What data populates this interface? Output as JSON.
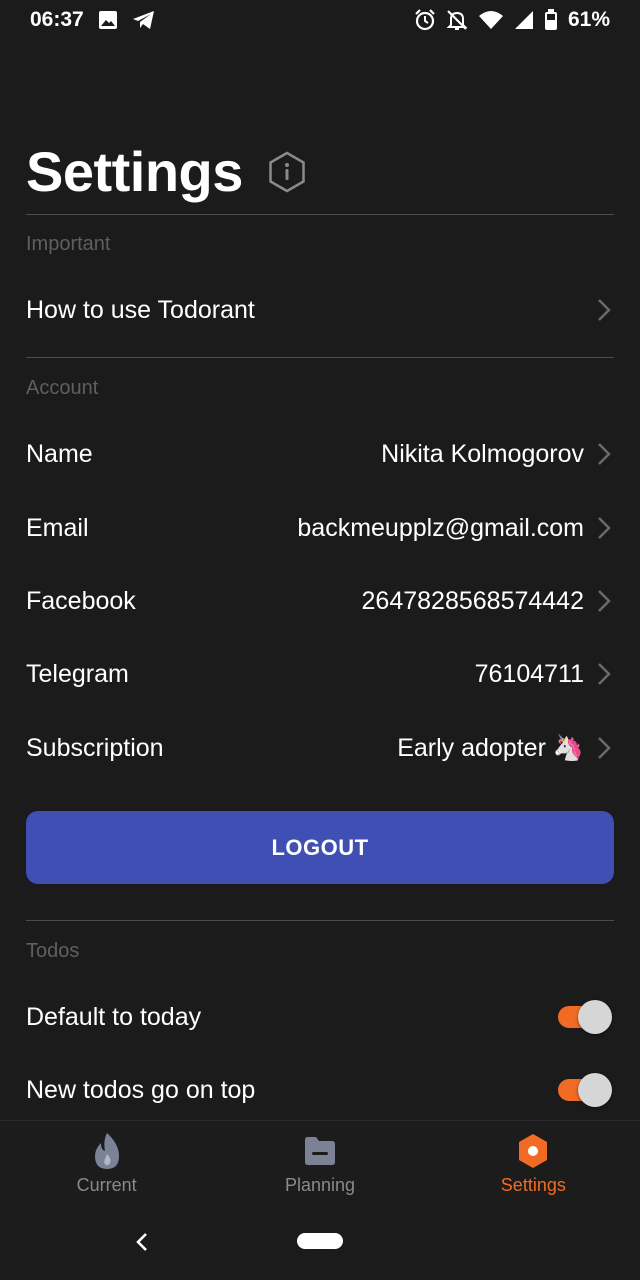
{
  "status_bar": {
    "time": "06:37",
    "battery": "61%",
    "icons_left": [
      "image-icon",
      "telegram-icon"
    ],
    "icons_right": [
      "alarm-icon",
      "notifications-off-icon",
      "wifi-icon",
      "signal-icon",
      "battery-icon"
    ]
  },
  "header": {
    "title": "Settings",
    "info_icon": "info-icon"
  },
  "sections": {
    "important": {
      "header": "Important",
      "items": [
        {
          "label": "How to use Todorant",
          "value": ""
        }
      ]
    },
    "account": {
      "header": "Account",
      "items": [
        {
          "label": "Name",
          "value": "Nikita Kolmogorov"
        },
        {
          "label": "Email",
          "value": "backmeupplz@gmail.com"
        },
        {
          "label": "Facebook",
          "value": "2647828568574442"
        },
        {
          "label": "Telegram",
          "value": "76104711"
        },
        {
          "label": "Subscription",
          "value": "Early adopter 🦄"
        }
      ],
      "logout_label": "LOGOUT"
    },
    "todos": {
      "header": "Todos",
      "items": [
        {
          "label": "Default to today",
          "enabled": true
        },
        {
          "label": "New todos go on top",
          "enabled": true
        }
      ]
    }
  },
  "bottom_nav": {
    "items": [
      {
        "label": "Current",
        "icon": "flame-icon",
        "active": false
      },
      {
        "label": "Planning",
        "icon": "folder-icon",
        "active": false
      },
      {
        "label": "Settings",
        "icon": "settings-hexagon-icon",
        "active": true
      }
    ]
  },
  "colors": {
    "background": "#1b1b1b",
    "accent": "#f26b24",
    "logout_button": "#3f4fb3",
    "section_header": "#5f5f5f",
    "divider": "#4a4a4a"
  }
}
